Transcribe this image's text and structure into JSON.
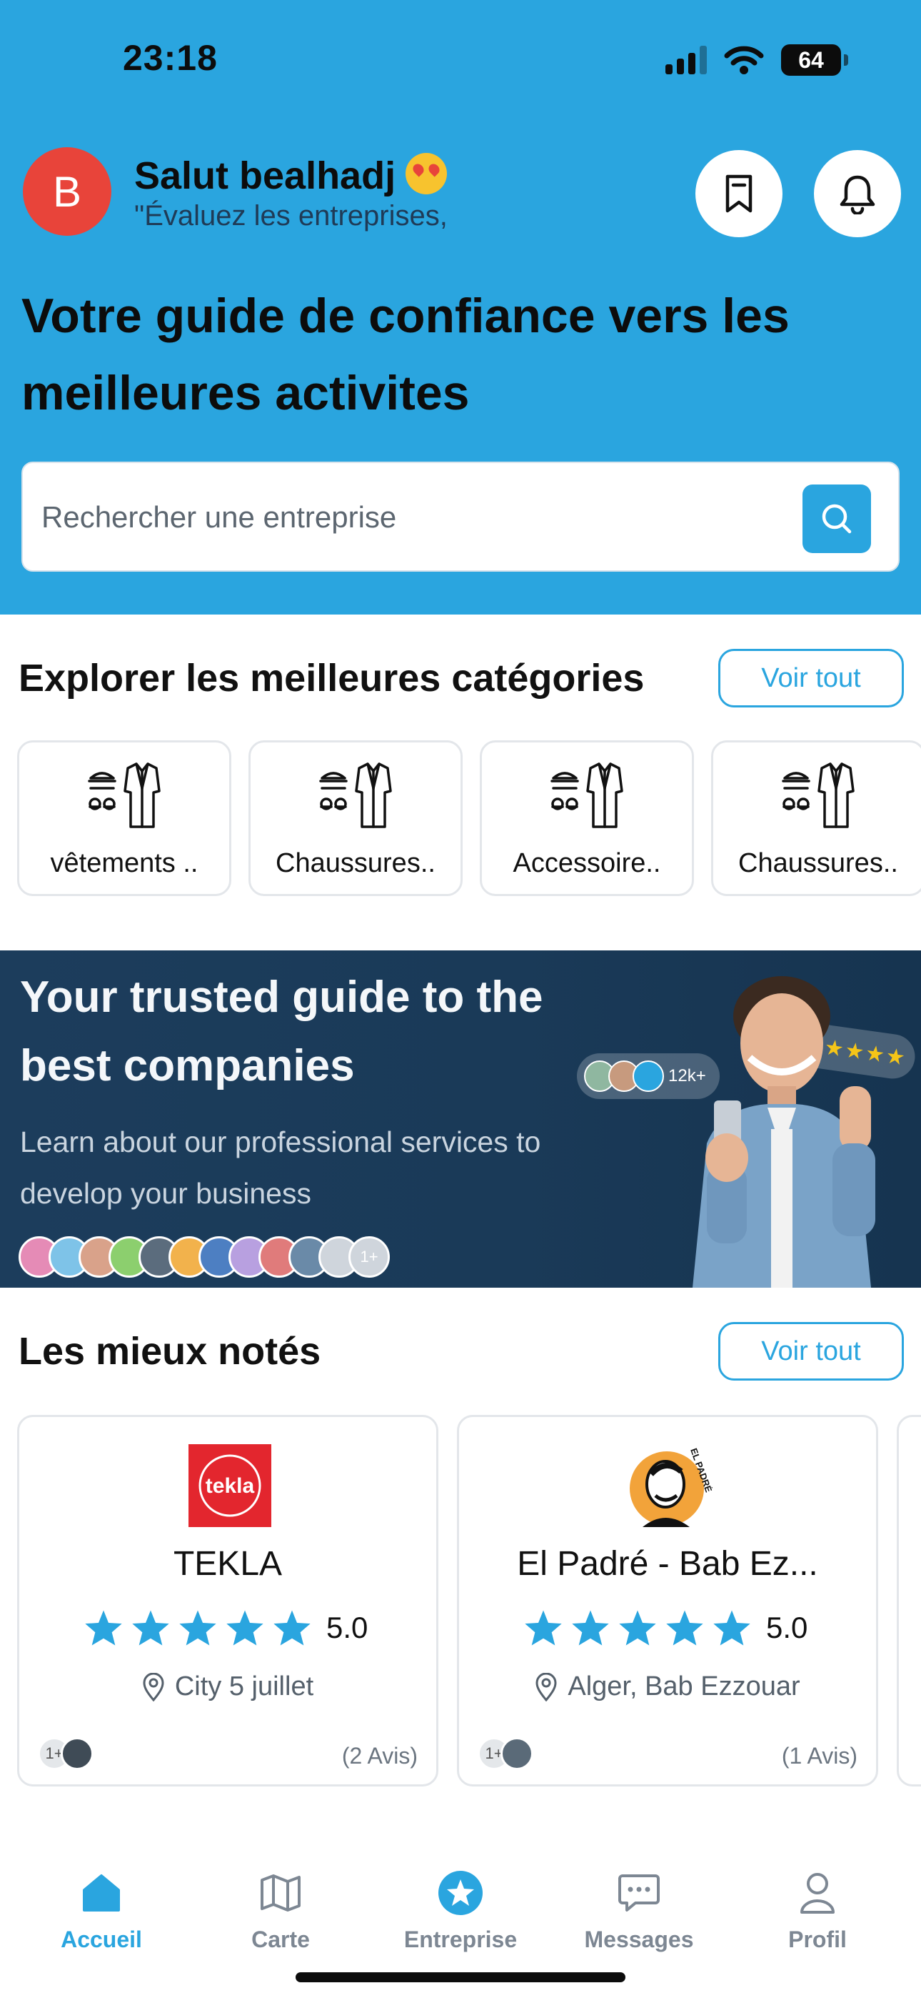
{
  "status_bar": {
    "time": "23:18",
    "battery": "64"
  },
  "header": {
    "avatar_letter": "B",
    "greeting": "Salut bealhadj",
    "subtitle": "\"Évaluez les entreprises,",
    "title": "Votre guide de confiance vers les meilleures activites"
  },
  "search": {
    "placeholder": "Rechercher une entreprise"
  },
  "categories": {
    "title": "Explorer les meilleures catégories",
    "see_all": "Voir tout",
    "items": [
      {
        "label": "vêtements .."
      },
      {
        "label": "Chaussures.."
      },
      {
        "label": "Accessoire.."
      },
      {
        "label": "Chaussures.."
      }
    ]
  },
  "banner": {
    "title": "Your trusted guide to the best companies",
    "subtitle": "Learn about our professional services to develop your business",
    "avatar_more": "1+",
    "users_badge": "12k+",
    "avatar_colors": [
      "#e58bb6",
      "#7ec3e8",
      "#d9a28a",
      "#8ccf6e",
      "#5b6c7d",
      "#f2b24c",
      "#4d7fc2",
      "#b8a0e0",
      "#e07b7b",
      "#6a8aa8",
      "#cfd5dc"
    ]
  },
  "top_rated": {
    "title": "Les mieux notés",
    "see_all": "Voir tout",
    "items": [
      {
        "name": "TEKLA",
        "rating": "5.0",
        "location": "City 5 juillet",
        "reviews": "(2 Avis)",
        "reviewers_more": "1+",
        "logo_text": "tekla"
      },
      {
        "name": "El Padré - Bab Ez...",
        "rating": "5.0",
        "location": "Alger, Bab Ezzouar",
        "reviews": "(1 Avis)",
        "reviewers_more": "1+",
        "logo_text": "EL PADRÉ"
      }
    ]
  },
  "nav": {
    "tabs": [
      {
        "label": "Accueil",
        "active": true
      },
      {
        "label": "Carte",
        "active": false
      },
      {
        "label": "Entreprise",
        "active": false
      },
      {
        "label": "Messages",
        "active": false
      },
      {
        "label": "Profil",
        "active": false
      }
    ]
  },
  "colors": {
    "accent": "#2aa5df",
    "avatar": "#e8443a",
    "banner": "#1c3d5c",
    "tekla_red": "#e3262e",
    "padre_orange": "#f2a33a"
  }
}
